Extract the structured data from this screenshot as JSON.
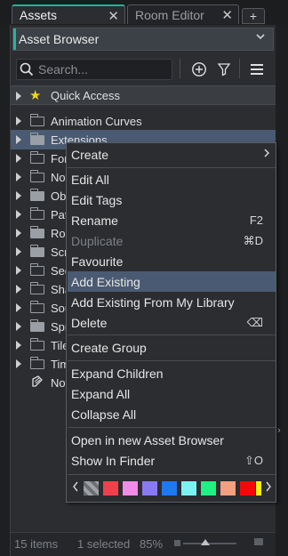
{
  "tabs": {
    "active_label": "Assets",
    "inactive_label": "Room Editor",
    "close_glyph": "✕",
    "add_glyph": "+"
  },
  "browser": {
    "selector_label": "Asset Browser",
    "accent_color": "#24b39c"
  },
  "search": {
    "placeholder": "Search..."
  },
  "toolbar": {
    "icons": [
      "add-icon",
      "filter-icon",
      "menu-icon"
    ]
  },
  "tree": {
    "quick_access": "Quick Access",
    "items": [
      {
        "label": "Animation Curves"
      },
      {
        "label": "Extensions"
      },
      {
        "label": "Fonts"
      },
      {
        "label": "Notes"
      },
      {
        "label": "Objects"
      },
      {
        "label": "Paths"
      },
      {
        "label": "Rooms"
      },
      {
        "label": "Scripts"
      },
      {
        "label": "Sequences"
      },
      {
        "label": "Shaders"
      },
      {
        "label": "Sounds"
      },
      {
        "label": "Sprites"
      },
      {
        "label": "Tile Sets"
      },
      {
        "label": "Timelines"
      },
      {
        "label": "Notes"
      }
    ]
  },
  "status": {
    "count": "15 items",
    "selected": "1 selected",
    "zoom": "85%"
  },
  "context_menu": {
    "items": {
      "create": "Create",
      "edit_all": "Edit All",
      "edit_tags": "Edit Tags",
      "rename": "Rename",
      "rename_shortcut": "F2",
      "duplicate": "Duplicate",
      "duplicate_shortcut": "⌘D",
      "favourite": "Favourite",
      "add_existing": "Add Existing",
      "add_existing_library": "Add Existing From My Library",
      "delete": "Delete",
      "delete_shortcut": "⌫",
      "create_group": "Create Group",
      "expand_children": "Expand Children",
      "expand_all": "Expand All",
      "collapse_all": "Collapse All",
      "open_new_browser": "Open in new Asset Browser",
      "show_in_finder": "Show In Finder",
      "show_in_finder_shortcut": "⇧O"
    },
    "colors": [
      "checker",
      "#f2404a",
      "#f28ae8",
      "#8a7af2",
      "#1e78f2",
      "#7af2f2",
      "#1ef280",
      "#f2a080",
      "#f20a0a",
      "#f2f20a"
    ]
  }
}
